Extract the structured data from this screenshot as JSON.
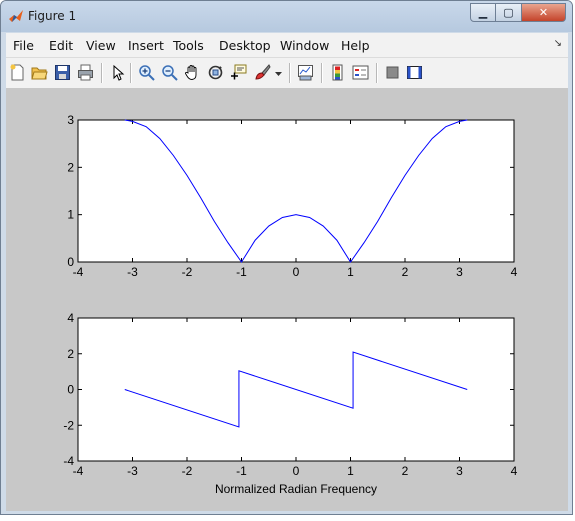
{
  "window": {
    "title": "Figure 1"
  },
  "menu": [
    "File",
    "Edit",
    "View",
    "Insert",
    "Tools",
    "Desktop",
    "Window",
    "Help"
  ],
  "toolbar_icons": [
    "new-figure-icon",
    "open-file-icon",
    "save-icon",
    "print-icon",
    "edit-plot-arrow-icon",
    "zoom-in-icon",
    "zoom-out-icon",
    "pan-hand-icon",
    "rotate-3d-icon",
    "data-cursor-icon",
    "brush-icon",
    "brush-dropdown-icon",
    "link-plot-icon",
    "colorbar-icon",
    "legend-icon",
    "hide-plot-tools-icon",
    "show-plot-tools-icon"
  ],
  "chart_data": [
    {
      "type": "line",
      "title": "",
      "xlabel": "",
      "ylabel": "",
      "xlim": [
        -4,
        4
      ],
      "ylim": [
        0,
        3
      ],
      "xticks": [
        -4,
        -3,
        -2,
        -1,
        0,
        1,
        2,
        3,
        4
      ],
      "yticks": [
        0,
        1,
        2,
        3
      ],
      "series": [
        {
          "color": "#0000ff",
          "x": [
            -3.1416,
            -3.0,
            -2.75,
            -2.5,
            -2.25,
            -2.0,
            -1.75,
            -1.5,
            -1.25,
            -1.0,
            -0.75,
            -0.5,
            -0.25,
            0.0,
            0.25,
            0.5,
            0.75,
            1.0,
            1.25,
            1.5,
            1.75,
            2.0,
            2.25,
            2.5,
            2.75,
            3.0,
            3.1416
          ],
          "y": [
            3.0,
            2.97,
            2.86,
            2.61,
            2.25,
            1.83,
            1.36,
            0.86,
            0.41,
            0.0,
            0.46,
            0.76,
            0.94,
            1.0,
            0.94,
            0.76,
            0.46,
            0.0,
            0.41,
            0.86,
            1.36,
            1.83,
            2.25,
            2.61,
            2.86,
            2.97,
            3.0
          ]
        }
      ]
    },
    {
      "type": "line",
      "title": "",
      "xlabel": "Normalized Radian Frequency",
      "ylabel": "",
      "xlim": [
        -4,
        4
      ],
      "ylim": [
        -4,
        4
      ],
      "xticks": [
        -4,
        -3,
        -2,
        -1,
        0,
        1,
        2,
        3,
        4
      ],
      "yticks": [
        -4,
        -2,
        0,
        2,
        4
      ],
      "series": [
        {
          "color": "#0000ff",
          "x": [
            -3.1416,
            -1.0472,
            -1.0472,
            1.0472,
            1.0472,
            3.1416
          ],
          "y": [
            0.0,
            -2.094,
            1.047,
            -1.047,
            2.094,
            0.0
          ]
        }
      ]
    }
  ]
}
